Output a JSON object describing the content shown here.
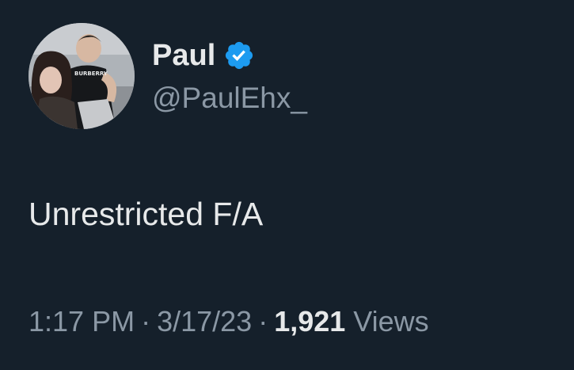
{
  "author": {
    "display_name": "Paul",
    "handle": "@PaulEhx_",
    "verified": true,
    "verified_icon": "verified-badge-icon",
    "verified_color": "#1d9bf0"
  },
  "avatar": {
    "description_icon": "profile-photo",
    "shirt_text": "BURBERRY"
  },
  "tweet": {
    "text": "Unrestricted F/A"
  },
  "meta": {
    "time": "1:17 PM",
    "separator": "·",
    "date": "3/17/23",
    "views_count": "1,921",
    "views_label": "Views"
  },
  "colors": {
    "background": "#15202b",
    "primary_text": "#e7e9ea",
    "secondary_text": "#8b98a5"
  }
}
